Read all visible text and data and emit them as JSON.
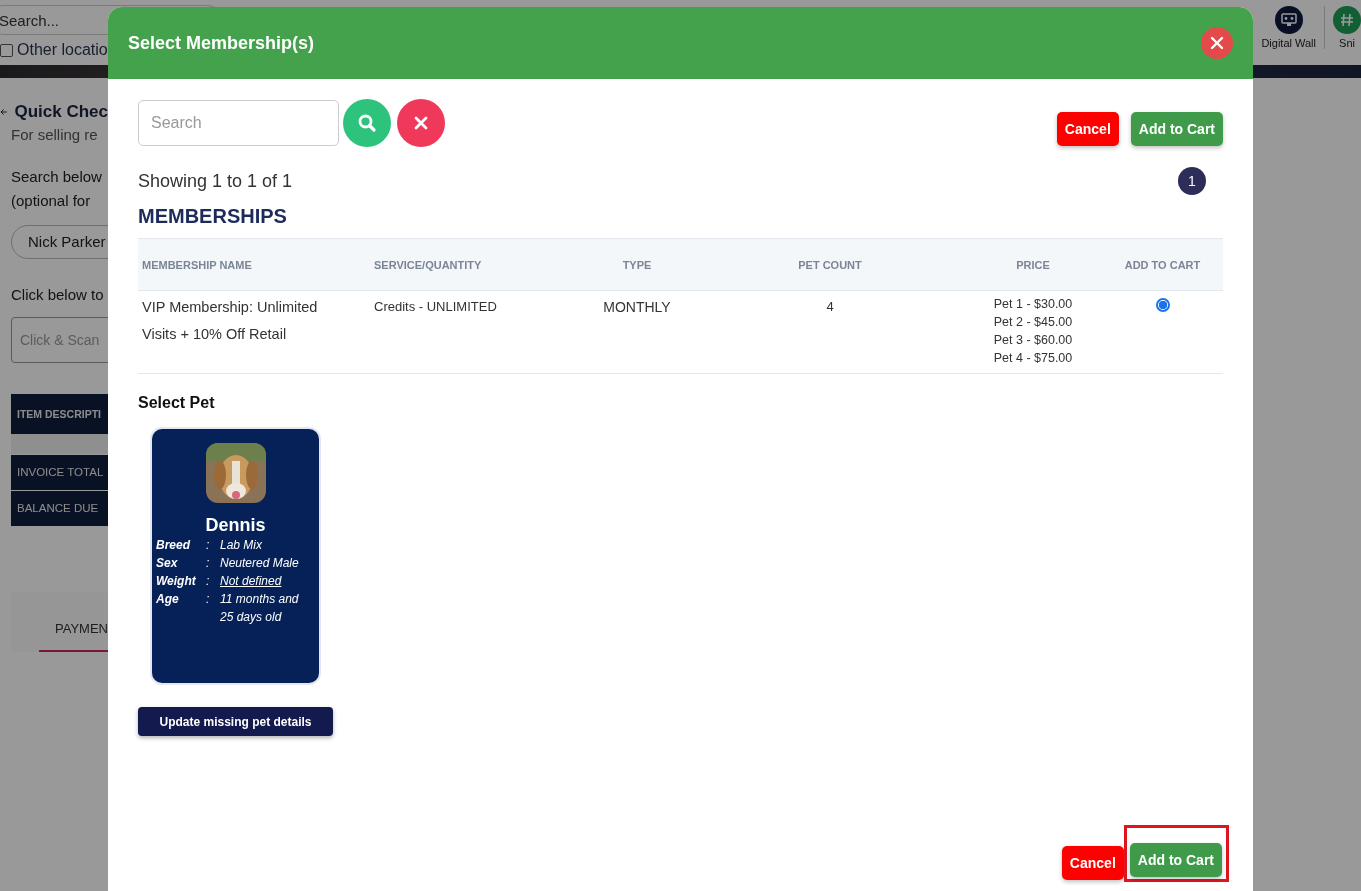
{
  "background": {
    "search": {
      "placeholder": "Search..."
    },
    "other_locations": {
      "label": "Other locatio",
      "checked": false
    },
    "toolbar": [
      {
        "label": "Digital Wall",
        "kind": "wall"
      },
      {
        "label": "Sni",
        "kind": "snip"
      }
    ],
    "page": {
      "title": "Quick Chec",
      "subtitle": "For selling re",
      "search_hint": [
        "Search below",
        "(optional for"
      ],
      "customer": "Nick Parker",
      "scan_hint": "Click below to",
      "scan_field": {
        "placeholder": "Click & Scan"
      },
      "item_header": "ITEM DESCRIPTI",
      "totals": [
        "INVOICE TOTAL",
        "BALANCE DUE"
      ],
      "tabs": [
        {
          "label": "PAYMEN",
          "selected": true
        }
      ]
    }
  },
  "modal": {
    "title": "Select Membership(s)",
    "search": {
      "placeholder": "Search"
    },
    "top_buttons": [
      {
        "label": "Cancel",
        "kind": "cancel"
      },
      {
        "label": "Add to Cart",
        "kind": "add"
      }
    ],
    "showing": "Showing 1 to 1 of 1",
    "pages": [
      {
        "label": "1",
        "selected": true
      }
    ],
    "section_title": "MEMBERSHIPS",
    "table": {
      "columns": [
        "MEMBERSHIP NAME",
        "SERVICE/QUANTITY",
        "TYPE",
        "PET COUNT",
        "PRICE",
        "ADD TO CART"
      ],
      "rows": [
        {
          "name": "VIP Membership: Unlimited Visits + 10% Off Retail",
          "service": "Credits - UNLIMITED",
          "type": "MONTHLY",
          "pet_count": "4",
          "prices": [
            "Pet 1 - $30.00",
            "Pet 2 - $45.00",
            "Pet 3 - $60.00",
            "Pet 4 - $75.00"
          ],
          "selected": true
        }
      ]
    },
    "select_pet": {
      "title": "Select Pet",
      "pets": [
        {
          "name": "Dennis",
          "fields": [
            {
              "label": "Breed",
              "separator": ":",
              "value": "Lab Mix",
              "underlined": false
            },
            {
              "label": "Sex",
              "separator": ":",
              "value": "Neutered Male",
              "underlined": false
            },
            {
              "label": "Weight",
              "separator": ":",
              "value": "Not defined",
              "underlined": true
            },
            {
              "label": "Age",
              "separator": ":",
              "value": "11 months and 25 days old",
              "underlined": false
            }
          ]
        }
      ],
      "update_button": "Update missing pet details"
    },
    "bottom_buttons": [
      {
        "label": "Cancel",
        "kind": "cancel",
        "highlighted": false
      },
      {
        "label": "Add to Cart",
        "kind": "add",
        "highlighted": true
      }
    ]
  }
}
